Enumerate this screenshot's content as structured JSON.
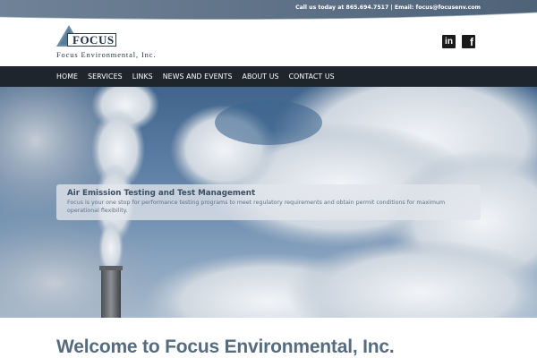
{
  "topbar": {
    "contact_text": "Call us today at 865.694.7517 | Email: focus@focusenv.com"
  },
  "header": {
    "logo_word": "FOCUS",
    "logo_subtitle": "Focus Environmental, Inc.",
    "social": [
      {
        "name": "linkedin",
        "glyph": "in"
      },
      {
        "name": "facebook",
        "glyph": "f"
      }
    ]
  },
  "nav": {
    "items": [
      "HOME",
      "SERVICES",
      "LINKS",
      "NEWS AND EVENTS",
      "ABOUT US",
      "CONTACT US"
    ]
  },
  "hero": {
    "title": "Air Emission Testing and Test Management",
    "text": "Focus is your one stop for performance testing programs to meet regulatory requirements and obtain permit conditions for maximum operational flexibility."
  },
  "welcome": {
    "heading": "Welcome to Focus Environmental, Inc."
  },
  "colors": {
    "nav_bg": "#1f252c",
    "topbar_bg": "#5b6f86",
    "heading": "#556b7f"
  },
  "icons": [
    "linkedin-icon",
    "facebook-icon",
    "logo-triangle-icon"
  ]
}
